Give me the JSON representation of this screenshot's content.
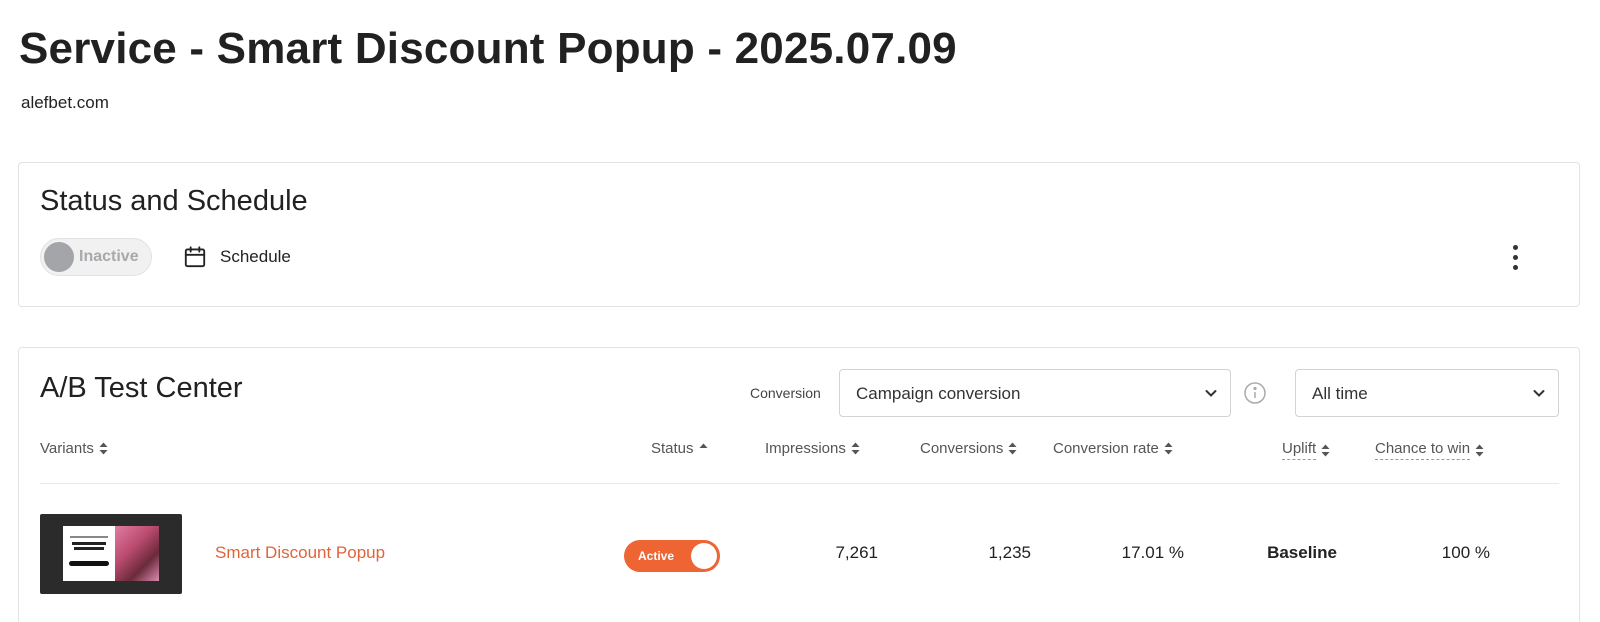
{
  "page": {
    "title": "Service - Smart Discount Popup - 2025.07.09",
    "subtitle": "alefbet.com"
  },
  "status_card": {
    "title": "Status and Schedule",
    "toggle_label": "Inactive",
    "schedule_label": "Schedule",
    "icons": {
      "schedule": "calendar-icon",
      "more": "more-vertical-icon"
    }
  },
  "ab_test": {
    "title": "A/B Test Center",
    "conversion_label": "Conversion",
    "conversion_select": "Campaign conversion",
    "time_select": "All time",
    "columns": {
      "variants": "Variants",
      "status": "Status",
      "impressions": "Impressions",
      "conversions": "Conversions",
      "conversion_rate": "Conversion rate",
      "uplift": "Uplift",
      "chance_to_win": "Chance to win"
    },
    "rows": [
      {
        "name": "Smart Discount Popup",
        "status": "Active",
        "impressions": "7,261",
        "conversions": "1,235",
        "conversion_rate": "17.01 %",
        "uplift": "Baseline",
        "chance_to_win": "100 %"
      }
    ]
  },
  "colors": {
    "accent": "#ee6433",
    "link": "#e0643b",
    "inactive_knob": "#a3a5a8"
  }
}
